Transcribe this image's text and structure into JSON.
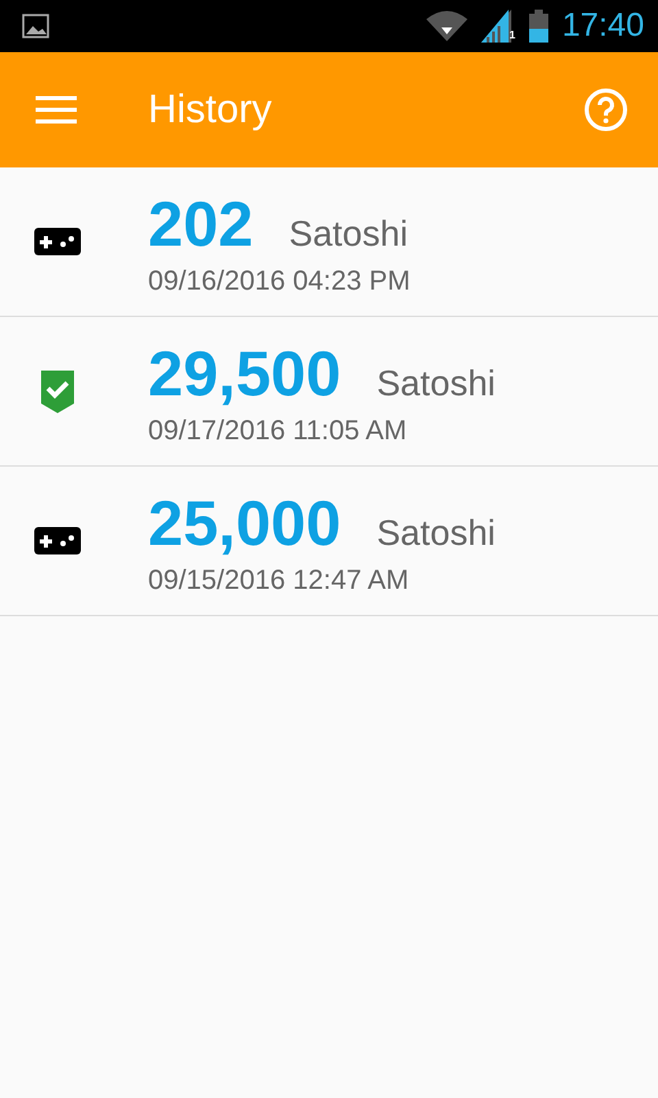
{
  "status_bar": {
    "sim": "1",
    "time": "17:40"
  },
  "app_bar": {
    "title": "History"
  },
  "history": [
    {
      "kind": "game",
      "amount": "202",
      "unit": "Satoshi",
      "date": "09/16/2016 04:23 PM"
    },
    {
      "kind": "verified",
      "amount": "29,500",
      "unit": "Satoshi",
      "date": "09/17/2016 11:05 AM"
    },
    {
      "kind": "game",
      "amount": "25,000",
      "unit": "Satoshi",
      "date": "09/15/2016 12:47 AM"
    }
  ]
}
